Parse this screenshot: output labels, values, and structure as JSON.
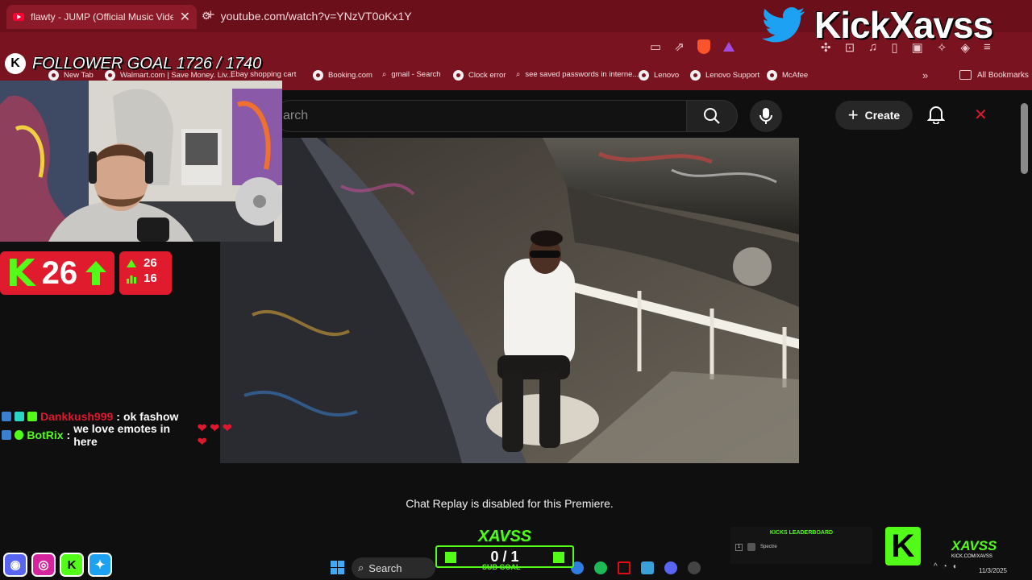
{
  "browser": {
    "tab_title": "flawty - JUMP (Official Music Video) - YouTube",
    "tab_close": "✕",
    "new_tab": "+",
    "url": "youtube.com/watch?v=YNzVT0oKx1Y",
    "bookmarks": [
      "New Tab",
      "Walmart.com | Save Money. Liv...",
      "Ebay shopping cart",
      "Booking.com",
      "gmail - Search",
      "Clock error",
      "see saved passwords in interne...",
      "Lenovo",
      "Lenovo Support",
      "McAfee"
    ],
    "bookmarks_more": "»",
    "all_bookmarks": "All Bookmarks"
  },
  "youtube": {
    "search_placeholder": "Search",
    "search_partial": "arch",
    "create_label": "Create",
    "chat_replay_text": "Chat Replay is disabled for this Premiere."
  },
  "overlay": {
    "brand_name": "KickXavss",
    "follower_goal": "FOLLOWER GOAL 1726 / 1740",
    "follower_badge": "K",
    "viewer_count": "26",
    "kick_letter": "K",
    "stats": {
      "up": "26",
      "bars": "16"
    },
    "chat": [
      {
        "user": "Dankkush999",
        "message": "ok fashow",
        "user_color": "#e0182d"
      },
      {
        "user": "BotRix",
        "message": "we love emotes in here",
        "user_color": "#53fc18"
      }
    ],
    "sub_goal": {
      "logo": "XAVSS",
      "count": "0 / 1",
      "label": "SUB GOAL"
    },
    "leaderboard": {
      "title": "KICKS LEADERBOARD",
      "rank": "1",
      "name": "Spectre"
    },
    "xavss_card": {
      "logo": "K",
      "name": "XAVSS",
      "sub": "KICK.COM/XAVSS"
    }
  },
  "taskbar": {
    "search_label": "Search",
    "date": "11/3/2025"
  },
  "colors": {
    "browser_frame": "#7a1320",
    "kick_green": "#53fc18",
    "counter_red": "#e01b2e",
    "youtube_bg": "#0f0f0f"
  }
}
